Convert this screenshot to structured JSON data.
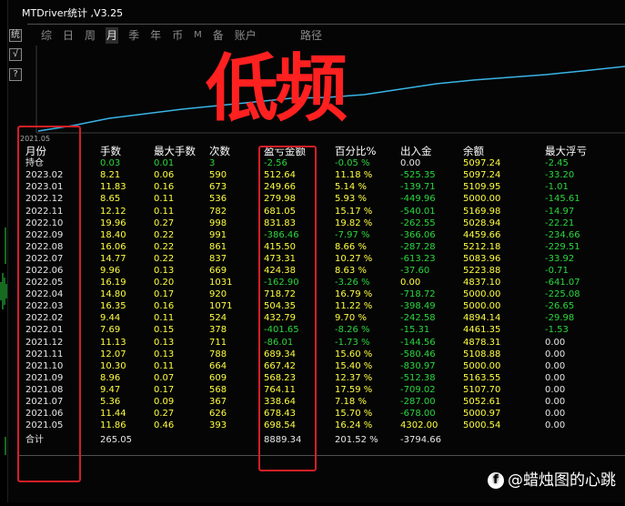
{
  "window": {
    "title": "MTDriver统计 ,V3.25"
  },
  "side_buttons": [
    {
      "name": "stats-button",
      "glyph": "统"
    },
    {
      "name": "check-button",
      "glyph": "√"
    },
    {
      "name": "help-button",
      "glyph": "?"
    }
  ],
  "tabs": [
    {
      "label": "综",
      "active": false
    },
    {
      "label": "日",
      "active": false
    },
    {
      "label": "周",
      "active": false
    },
    {
      "label": "月",
      "active": true
    },
    {
      "label": "季",
      "active": false
    },
    {
      "label": "年",
      "active": false
    },
    {
      "label": "币",
      "active": false
    },
    {
      "label": "M",
      "active": false
    },
    {
      "label": "备",
      "active": false
    },
    {
      "label": "账户",
      "active": false
    }
  ],
  "path_label": "路径",
  "chart": {
    "start_date": "2021.05",
    "line_color": "#3ab4e6"
  },
  "overlay_text": "低频",
  "colors": {
    "positive": "#2bd63f",
    "negative": "#ffff40",
    "highlight_box": "#d41f28",
    "background": "#050505"
  },
  "table": {
    "headers": [
      "月份",
      "手数",
      "最大手数",
      "次数",
      "盈亏金额",
      "百分比%",
      "出入金",
      "余额",
      "最大浮亏"
    ],
    "rows": [
      [
        "持仓",
        "0.03",
        "0.01",
        "3",
        "-2.56",
        "-0.05 %",
        "0.00",
        "5097.24",
        "-2.45"
      ],
      [
        "2023.02",
        "8.21",
        "0.06",
        "590",
        "512.64",
        "11.18 %",
        "-525.35",
        "5097.24",
        "-33.20"
      ],
      [
        "2023.01",
        "11.83",
        "0.16",
        "673",
        "249.66",
        "5.14 %",
        "-139.71",
        "5109.95",
        "-1.01"
      ],
      [
        "2022.12",
        "8.65",
        "0.11",
        "536",
        "279.98",
        "5.93 %",
        "-449.96",
        "5000.00",
        "-145.61"
      ],
      [
        "2022.11",
        "12.12",
        "0.11",
        "782",
        "681.05",
        "15.17 %",
        "-540.01",
        "5169.98",
        "-14.97"
      ],
      [
        "2022.10",
        "19.96",
        "0.27",
        "998",
        "831.83",
        "19.82 %",
        "-262.55",
        "5028.94",
        "-22.21"
      ],
      [
        "2022.09",
        "18.40",
        "0.22",
        "991",
        "-386.46",
        "-7.97 %",
        "-366.06",
        "4459.66",
        "-234.66"
      ],
      [
        "2022.08",
        "16.06",
        "0.22",
        "861",
        "415.50",
        "8.66 %",
        "-287.28",
        "5212.18",
        "-229.51"
      ],
      [
        "2022.07",
        "14.77",
        "0.22",
        "837",
        "473.31",
        "10.27 %",
        "-613.23",
        "5083.96",
        "-33.92"
      ],
      [
        "2022.06",
        "9.96",
        "0.13",
        "669",
        "424.38",
        "8.63 %",
        "-37.60",
        "5223.88",
        "-0.71"
      ],
      [
        "2022.05",
        "16.19",
        "0.20",
        "1031",
        "-162.90",
        "-3.26 %",
        "0.00",
        "4837.10",
        "-641.07"
      ],
      [
        "2022.04",
        "14.80",
        "0.17",
        "920",
        "718.72",
        "16.79 %",
        "-718.72",
        "5000.00",
        "-225.08"
      ],
      [
        "2022.03",
        "16.35",
        "0.16",
        "1071",
        "504.35",
        "11.22 %",
        "-398.49",
        "5000.00",
        "-26.65"
      ],
      [
        "2022.02",
        "9.44",
        "0.11",
        "524",
        "432.79",
        "9.70 %",
        "-242.58",
        "4894.14",
        "-29.98"
      ],
      [
        "2022.01",
        "7.69",
        "0.15",
        "378",
        "-401.65",
        "-8.26 %",
        "-15.31",
        "4461.35",
        "-1.53"
      ],
      [
        "2021.12",
        "11.13",
        "0.13",
        "711",
        "-86.01",
        "-1.73 %",
        "-144.56",
        "4878.31",
        "0.00"
      ],
      [
        "2021.11",
        "12.07",
        "0.13",
        "788",
        "689.34",
        "15.60 %",
        "-580.46",
        "5108.88",
        "0.00"
      ],
      [
        "2021.10",
        "10.30",
        "0.11",
        "664",
        "667.42",
        "15.40 %",
        "-830.97",
        "5000.00",
        "0.00"
      ],
      [
        "2021.09",
        "8.96",
        "0.07",
        "609",
        "568.23",
        "12.37 %",
        "-512.38",
        "5163.55",
        "0.00"
      ],
      [
        "2021.08",
        "9.47",
        "0.17",
        "568",
        "764.11",
        "17.59 %",
        "-709.02",
        "5107.70",
        "0.00"
      ],
      [
        "2021.07",
        "5.36",
        "0.09",
        "367",
        "338.64",
        "7.18 %",
        "-287.00",
        "5052.61",
        "0.00"
      ],
      [
        "2021.06",
        "11.44",
        "0.27",
        "626",
        "678.43",
        "15.70 %",
        "-678.00",
        "5000.97",
        "0.00"
      ],
      [
        "2021.05",
        "11.86",
        "0.46",
        "393",
        "698.54",
        "16.24 %",
        "4302.00",
        "5000.54",
        "0.00"
      ]
    ],
    "total_row": [
      "合计",
      "265.05",
      "",
      "",
      "8889.34",
      "201.52 %",
      "-3794.66",
      "",
      ""
    ]
  },
  "watermark": {
    "icon": "f",
    "text": "@蜡烛图的心跳"
  }
}
